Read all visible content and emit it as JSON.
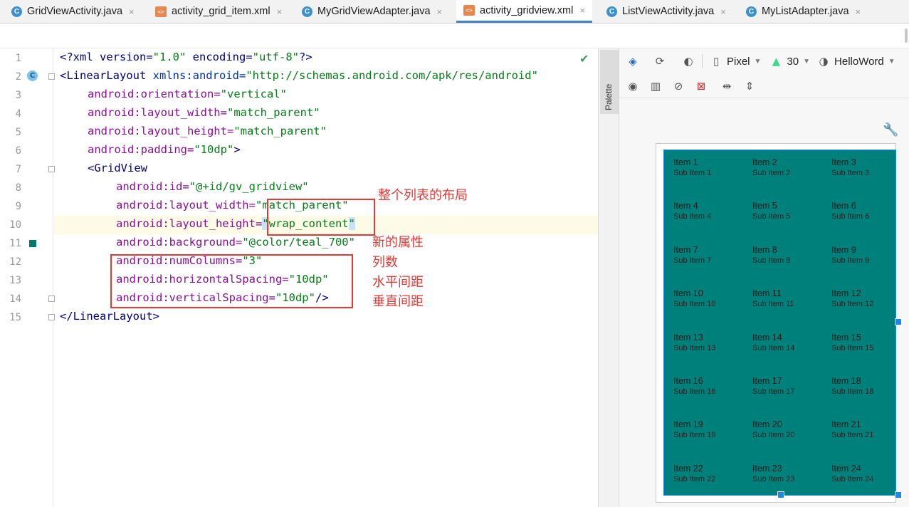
{
  "tabs": [
    {
      "label": "GridViewActivity.java",
      "icon": "class-icon"
    },
    {
      "label": "activity_grid_item.xml",
      "icon": "xml-icon"
    },
    {
      "label": "MyGridViewAdapter.java",
      "icon": "class-icon"
    },
    {
      "label": "activity_gridview.xml",
      "icon": "xml-icon",
      "active": true
    },
    {
      "label": "ListViewActivity.java",
      "icon": "class-icon"
    },
    {
      "label": "MyListAdapter.java",
      "icon": "class-icon"
    }
  ],
  "close_glyph": "×",
  "line_numbers": [
    "1",
    "2",
    "3",
    "4",
    "5",
    "6",
    "7",
    "8",
    "9",
    "10",
    "11",
    "12",
    "13",
    "14",
    "15"
  ],
  "code": {
    "l1_a": "<?xml version=",
    "l1_b": "\"1.0\"",
    "l1_c": " encoding=",
    "l1_d": "\"utf-8\"",
    "l1_e": "?>",
    "l2_a": "<LinearLayout ",
    "l2_b": "xmlns:android",
    "l2_c": "=",
    "l2_d": "\"http://schemas.android.com/apk/res/android\"",
    "l3_a": "android:orientation",
    "l3_b": "=",
    "l3_c": "\"vertical\"",
    "l4_a": "android:layout_width",
    "l4_b": "=",
    "l4_c": "\"match_parent\"",
    "l5_a": "android:layout_height",
    "l5_b": "=",
    "l5_c": "\"match_parent\"",
    "l6_a": "android:padding",
    "l6_b": "=",
    "l6_c": "\"10dp\"",
    "l6_d": ">",
    "l7_a": "<GridView",
    "l8_a": "android:id",
    "l8_b": "=",
    "l8_c": "\"@+id/gv_gridview\"",
    "l9_a": "android:layout_width",
    "l9_b": "=",
    "l9_c": "\"match_parent\"",
    "l10_a": "android:layout_height",
    "l10_b": "=",
    "l10_c": "\"",
    "l10_d": "wrap_content",
    "l10_e": "\"",
    "l11_a": "android:background",
    "l11_b": "=",
    "l11_c": "\"@color/teal_700\"",
    "l12_a": "android:numColumns",
    "l12_b": "=",
    "l12_c": "\"3\"",
    "l13_a": "android:horizontalSpacing",
    "l13_b": "=",
    "l13_c": "\"10dp\"",
    "l14_a": "android:verticalSpacing",
    "l14_b": "=",
    "l14_c": "\"10dp\"",
    "l14_d": "/>",
    "l15_a": "</LinearLayout>"
  },
  "annotations": {
    "layout": "整个列表的布局",
    "new_attrs": "新的属性",
    "columns": "列数",
    "hspacing": "水平间距",
    "vspacing": "垂直间距"
  },
  "palette_label": "Palette",
  "design_toolbar": {
    "device": "Pixel",
    "api": "30",
    "theme": "HelloWord"
  },
  "grid_items": [
    {
      "title": "Item 1",
      "sub": "Sub Item 1"
    },
    {
      "title": "Item 2",
      "sub": "Sub Item 2"
    },
    {
      "title": "Item 3",
      "sub": "Sub Item 3"
    },
    {
      "title": "Item 4",
      "sub": "Sub Item 4"
    },
    {
      "title": "Item 5",
      "sub": "Sub Item 5"
    },
    {
      "title": "Item 6",
      "sub": "Sub Item 6"
    },
    {
      "title": "Item 7",
      "sub": "Sub Item 7"
    },
    {
      "title": "Item 8",
      "sub": "Sub Item 8"
    },
    {
      "title": "Item 9",
      "sub": "Sub Item 9"
    },
    {
      "title": "Item 10",
      "sub": "Sub Item 10"
    },
    {
      "title": "Item 11",
      "sub": "Sub Item 11"
    },
    {
      "title": "Item 12",
      "sub": "Sub Item 12"
    },
    {
      "title": "Item 13",
      "sub": "Sub Item 13"
    },
    {
      "title": "Item 14",
      "sub": "Sub Item 14"
    },
    {
      "title": "Item 15",
      "sub": "Sub Item 15"
    },
    {
      "title": "Item 16",
      "sub": "Sub Item 16"
    },
    {
      "title": "Item 17",
      "sub": "Sub Item 17"
    },
    {
      "title": "Item 18",
      "sub": "Sub Item 18"
    },
    {
      "title": "Item 19",
      "sub": "Sub Item 19"
    },
    {
      "title": "Item 20",
      "sub": "Sub Item 20"
    },
    {
      "title": "Item 21",
      "sub": "Sub Item 21"
    },
    {
      "title": "Item 22",
      "sub": "Sub Item 22"
    },
    {
      "title": "Item 23",
      "sub": "Sub Item 23"
    },
    {
      "title": "Item 24",
      "sub": "Sub Item 24"
    }
  ],
  "colors": {
    "teal_700": "#00807a",
    "annotation_red": "#e53935",
    "active_tab_underline": "#4083c9"
  }
}
